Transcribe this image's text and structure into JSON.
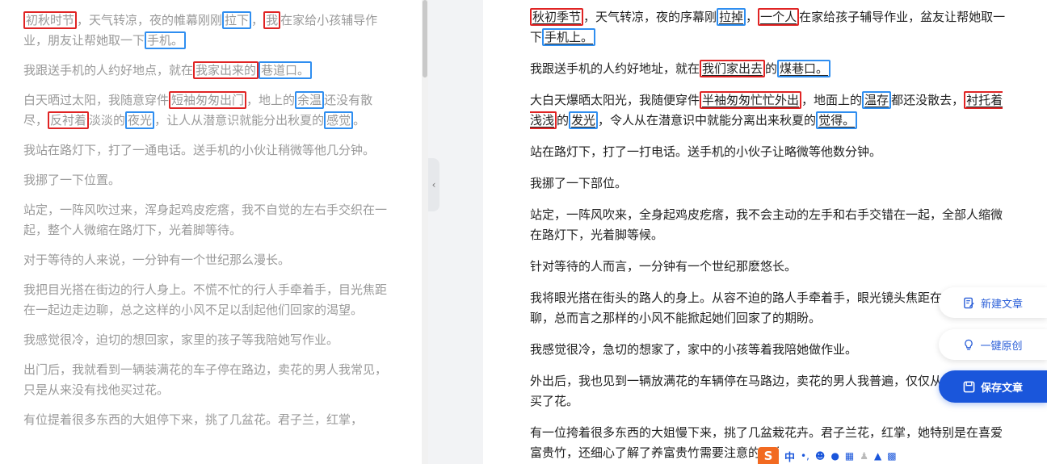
{
  "left": {
    "paragraphs": [
      {
        "segments": [
          {
            "text": "初秋时节",
            "hl": "red"
          },
          {
            "text": "，天气转凉，夜的帷幕刚刚"
          },
          {
            "text": "拉下",
            "hl": "blue"
          },
          {
            "text": "，"
          },
          {
            "text": "我",
            "hl": "red"
          },
          {
            "text": "在家给小孩辅导作业，朋友让帮她取一下"
          },
          {
            "text": "手机。",
            "hl": "blue"
          }
        ]
      },
      {
        "segments": [
          {
            "text": "我跟送手机的人约好地点，就在"
          },
          {
            "text": "我家出来的",
            "hl": "red"
          },
          {
            "text": "巷道口。",
            "hl": "blue"
          }
        ]
      },
      {
        "segments": [
          {
            "text": "白天晒过太阳，我随意穿件"
          },
          {
            "text": "短袖匆匆出门",
            "hl": "red"
          },
          {
            "text": "，地上的"
          },
          {
            "text": "余温",
            "hl": "blue"
          },
          {
            "text": "还没有散尽，"
          },
          {
            "text": "反衬着",
            "hl": "red"
          },
          {
            "text": "淡淡的"
          },
          {
            "text": "夜光",
            "hl": "blue"
          },
          {
            "text": "，让人从潜意识就能分出秋夏的"
          },
          {
            "text": "感觉",
            "hl": "blue"
          },
          {
            "text": "。"
          }
        ]
      },
      {
        "segments": [
          {
            "text": "我站在路灯下，打了一通电话。送手机的小伙让稍微等他几分钟。"
          }
        ]
      },
      {
        "segments": [
          {
            "text": "我挪了一下位置。"
          }
        ]
      },
      {
        "segments": [
          {
            "text": "站定，一阵风吹过来，浑身起鸡皮疙瘩，我不自觉的左右手交织在一起，整个人微缩在路灯下，光着脚等待。"
          }
        ]
      },
      {
        "segments": [
          {
            "text": "对于等待的人来说，一分钟有一个世纪那么漫长。"
          }
        ]
      },
      {
        "segments": [
          {
            "text": "我把目光搭在街边的行人身上。不慌不忙的行人手牵着手，目光焦距在一起边走边聊，总之这样的小风不足以刮起他们回家的渴望。"
          }
        ]
      },
      {
        "segments": [
          {
            "text": "我感觉很冷，迫切的想回家，家里的孩子等我陪她写作业。"
          }
        ]
      },
      {
        "segments": [
          {
            "text": "出门后，我就看到一辆装满花的车子停在路边，卖花的男人我常见，只是从来没有找他买过花。"
          }
        ]
      },
      {
        "segments": [
          {
            "text": "有位提着很多东西的大姐停下来，挑了几盆花。君子兰，红掌，"
          }
        ]
      }
    ]
  },
  "right": {
    "paragraphs": [
      {
        "segments": [
          {
            "text": "秋初季节",
            "hl": "red"
          },
          {
            "text": "，天气转凉，夜的序幕刚"
          },
          {
            "text": "拉掉",
            "hl": "blue"
          },
          {
            "text": "，"
          },
          {
            "text": "一个人",
            "hl": "red"
          },
          {
            "text": "在家给孩子辅导作业，盆友让帮她取一下"
          },
          {
            "text": "手机上。",
            "hl": "blue"
          }
        ]
      },
      {
        "segments": [
          {
            "text": "我跟送手机的人约好地址，就在"
          },
          {
            "text": "我们家出去",
            "hl": "red"
          },
          {
            "text": "的"
          },
          {
            "text": "煤巷口。",
            "hl": "blue"
          }
        ]
      },
      {
        "segments": [
          {
            "text": "大白天爆晒太阳光，我随便穿件"
          },
          {
            "text": "半袖匆匆忙忙外出",
            "hl": "red"
          },
          {
            "text": "，地面上的"
          },
          {
            "text": "温存",
            "hl": "blue"
          },
          {
            "text": "都还没散去，"
          },
          {
            "text": "衬托着浅浅",
            "hl": "red"
          },
          {
            "text": "的"
          },
          {
            "text": "发光",
            "hl": "blue"
          },
          {
            "text": "，令人从在潜意识中就能分离出来秋夏的"
          },
          {
            "text": "觉得。",
            "hl": "blue"
          }
        ]
      },
      {
        "segments": [
          {
            "text": "站在路灯下，打了一打电话。送手机的小伙子让略微等他数分钟。"
          }
        ]
      },
      {
        "segments": [
          {
            "text": "我挪了一下部位。"
          }
        ]
      },
      {
        "segments": [
          {
            "text": "站定，一阵风吹来，全身起鸡皮疙瘩，我不会主动的左手和右手交错在一起，全部人缩微在路灯下，光着脚等候。"
          }
        ]
      },
      {
        "segments": [
          {
            "text": "针对等待的人而言，一分钟有一个世纪那麽悠长。"
          }
        ]
      },
      {
        "segments": [
          {
            "text": "我将眼光搭在街头的路人的身上。从容不迫的路人手牵着手，眼光镜头焦距在一起边走边聊，总而言之那样的小风不能掀起她们回家了的期盼。"
          }
        ]
      },
      {
        "segments": [
          {
            "text": "我感觉很冷，急切的想家了，家中的小孩等着我陪她做作业。"
          }
        ]
      },
      {
        "segments": [
          {
            "text": "外出后，我也见到一辆放满花的车辆停在马路边，卖花的男人我普遍，仅仅从来没有找他买了花。"
          }
        ]
      },
      {
        "segments": [
          {
            "text": "有一位挎着很多东西的大姐慢下来，挑了几盆栽花卉。君子兰花，红掌，她特别是在喜爱富贵竹，还细心了解了养富贵竹需要注意的一次。"
          }
        ]
      }
    ]
  },
  "buttons": {
    "new_article": "新建文章",
    "one_click_original": "一键原创",
    "save_article": "保存文章"
  },
  "ime": {
    "logo": "S",
    "mode": "中",
    "icons": [
      "punctuation-icon",
      "emoji-icon",
      "mic-icon",
      "keyboard-icon",
      "user-icon",
      "skin-icon",
      "grid-icon"
    ]
  },
  "colors": {
    "highlight_red": "#e02424",
    "highlight_blue": "#2f8ef0",
    "save_button": "#1a56db",
    "ime_logo": "#f26a21"
  }
}
